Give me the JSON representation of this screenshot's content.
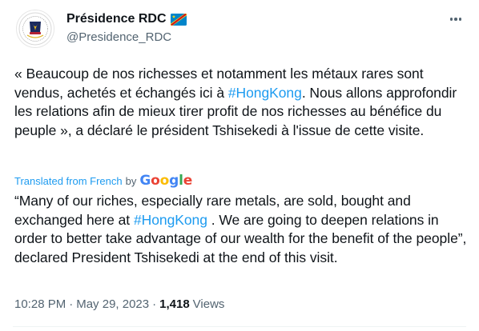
{
  "account": {
    "display_name": "Présidence RDC",
    "handle": "@Presidence_RDC"
  },
  "icons": {
    "flag": "drc-flag-icon",
    "more": "more-options-icon",
    "avatar": "presidency-seal"
  },
  "tweet": {
    "original_parts": [
      "« Beaucoup de nos richesses et notamment les métaux rares sont vendus, achetés et échangés ici à ",
      "#HongKong",
      ". Nous allons approfondir les relations afin de mieux tirer profit de nos richesses au bénéfice du peuple », a déclaré le président Tshisekedi à l'issue de cette visite."
    ],
    "translated_from": "Translated from French",
    "by": "by",
    "google": [
      "G",
      "o",
      "o",
      "g",
      "l",
      "e"
    ],
    "translation_parts": [
      "“Many of our riches, especially rare metals, are sold, bought and exchanged here at ",
      "#HongKong",
      " . We are going to deepen relations in order to better take advantage of our wealth for the benefit of the people”, declared President Tshisekedi at the end of this visit."
    ],
    "time": "10:28 PM",
    "separator": "·",
    "date": "May 29, 2023",
    "views_count": "1,418",
    "views_label": "Views"
  },
  "colors": {
    "link": "#1d9bf0",
    "secondary_text": "#536471",
    "primary_text": "#0f1419"
  }
}
